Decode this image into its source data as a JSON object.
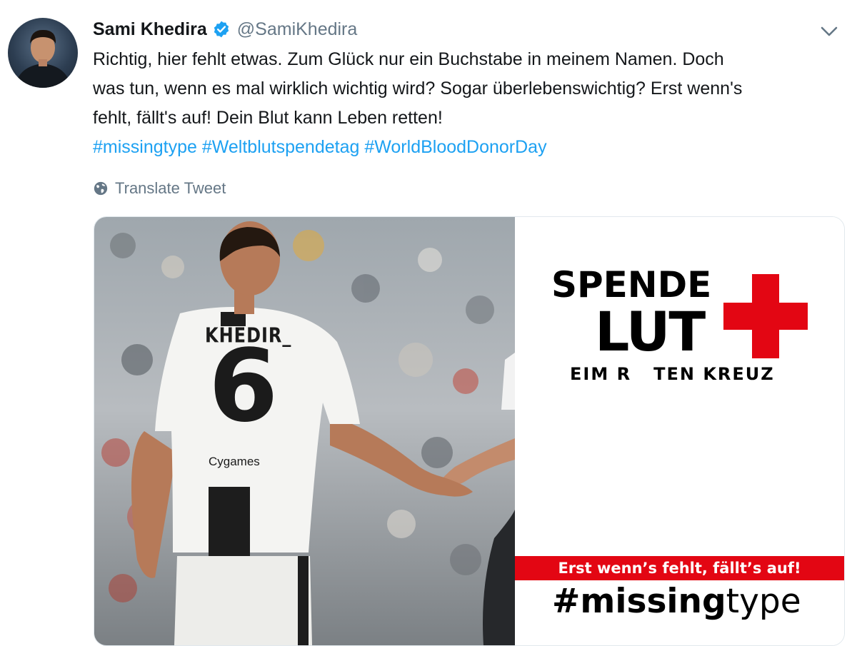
{
  "tweet": {
    "author_name": "Sami Khedira",
    "handle": "@SamiKhedira",
    "text_lines": [
      "Richtig, hier fehlt etwas. Zum Glück nur ein Buchstabe in meinem Namen. Doch",
      "was tun, wenn es mal wirklich wichtig wird? Sogar überlebenswichtig? Erst wenn's",
      "fehlt, fällt's auf! Dein Blut kann Leben retten!"
    ],
    "hashtags": [
      "#missingtype",
      "#Weltblutspendetag",
      "#WorldBloodDonorDay"
    ],
    "translate_label": "Translate Tweet"
  },
  "image": {
    "jersey_name": "KHEDIR_",
    "jersey_number": "6",
    "sponsor": "Cygames",
    "logo_line1": "SPENDE",
    "logo_line2": "LUT",
    "logo_line3": "EIM R   TEN KREUZ",
    "banner": "Erst wenn’s fehlt, fällt’s auf!",
    "campaign_bold": "#missing",
    "campaign_light": "type"
  },
  "colors": {
    "link": "#1da1f2",
    "secondary_text": "#657786",
    "verified": "#1da1f2",
    "red_cross": "#e30613"
  },
  "icons": {
    "verified": "verified-badge-icon",
    "caret": "chevron-down-icon",
    "translate": "globe-icon"
  }
}
